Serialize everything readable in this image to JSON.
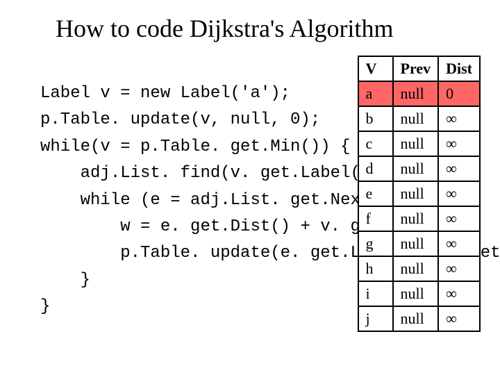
{
  "title": "How to code Dijkstra's Algorithm",
  "code": "Label v = new Label('a');\np.Table. update(v, null, 0);\nwhile(v = p.Table. get.Min()) {\n    adj.List. find(v. get.Label());\n    while (e = adj.List. get.Next()) {\n        w = e. get.Dist() + v. get.Dist();\n        p.Table. update(e. get.Label(), v. get.Label(), w);\n    }\n}",
  "table": {
    "headers": [
      "V",
      "Prev",
      "Dist"
    ],
    "rows": [
      {
        "v": "a",
        "prev": "null",
        "dist": "0",
        "highlight": true
      },
      {
        "v": "b",
        "prev": "null",
        "dist": "∞",
        "highlight": false
      },
      {
        "v": "c",
        "prev": "null",
        "dist": "∞",
        "highlight": false
      },
      {
        "v": "d",
        "prev": "null",
        "dist": "∞",
        "highlight": false
      },
      {
        "v": "e",
        "prev": "null",
        "dist": "∞",
        "highlight": false
      },
      {
        "v": "f",
        "prev": "null",
        "dist": "∞",
        "highlight": false
      },
      {
        "v": "g",
        "prev": "null",
        "dist": "∞",
        "highlight": false
      },
      {
        "v": "h",
        "prev": "null",
        "dist": "∞",
        "highlight": false
      },
      {
        "v": "i",
        "prev": "null",
        "dist": "∞",
        "highlight": false
      },
      {
        "v": "j",
        "prev": "null",
        "dist": "∞",
        "highlight": false
      }
    ]
  }
}
